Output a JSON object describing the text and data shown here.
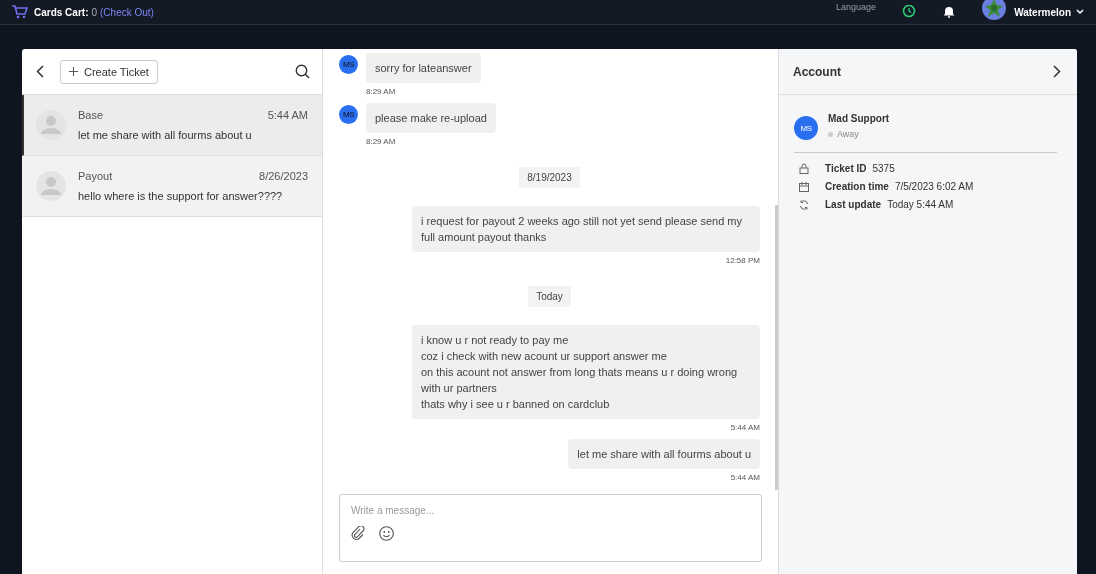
{
  "topbar": {
    "cart_label": "Cards Cart:",
    "cart_count": "0",
    "checkout_link": "(Check Out)",
    "language": "Language",
    "username": "Watermelon"
  },
  "tickets": {
    "create_button": "Create Ticket",
    "items": [
      {
        "title": "Base",
        "time": "5:44 AM",
        "preview": "let me share with all fourms about u",
        "selected": true
      },
      {
        "title": "Payout",
        "time": "8/26/2023",
        "preview": "hello where is the support for answer????",
        "selected": false
      }
    ]
  },
  "chat": {
    "messages": [
      {
        "kind": "incoming",
        "avatar": "MS",
        "lines": [
          "sorry for lateanswer"
        ],
        "time": "8:29 AM"
      },
      {
        "kind": "incoming",
        "avatar": "MS",
        "lines": [
          "please make re-upload"
        ],
        "time": "8:29 AM"
      },
      {
        "kind": "date",
        "text": "8/19/2023"
      },
      {
        "kind": "outgoing",
        "lines": [
          "i request for payout 2 weeks ago still not yet send please send my full amount payout thanks"
        ],
        "time": "12:58 PM"
      },
      {
        "kind": "date",
        "text": "Today"
      },
      {
        "kind": "outgoing",
        "lines": [
          "i know u r not ready to pay me",
          "coz i check with new acount ur support answer me",
          "on this acount not answer from long thats means u r doing wrong with ur partners",
          "thats why i see u r banned on cardclub"
        ],
        "time": "5:44 AM"
      },
      {
        "kind": "outgoing",
        "lines": [
          "let me share with all fourms about u"
        ],
        "time": "5:44 AM"
      }
    ],
    "composer": {
      "placeholder": "Write a message..."
    }
  },
  "account": {
    "title": "Account",
    "avatar": "MS",
    "name": "Mad Support",
    "status": "Away",
    "details": [
      {
        "kind": "lock",
        "label": "Ticket ID",
        "value": "5375"
      },
      {
        "kind": "calendar",
        "label": "Creation time",
        "value": "7/5/2023 6:02 AM"
      },
      {
        "kind": "refresh",
        "label": "Last update",
        "value": "Today 5:44 AM"
      }
    ]
  }
}
